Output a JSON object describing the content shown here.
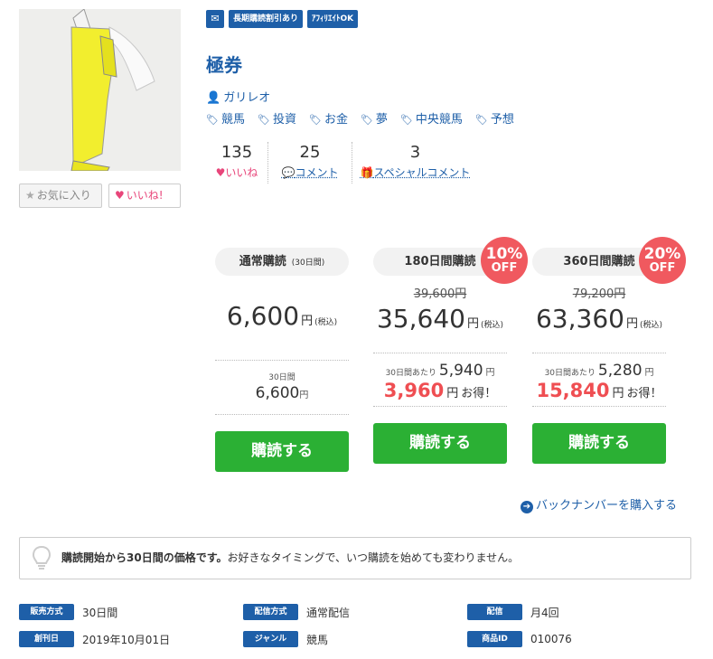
{
  "badges": [
    "✉",
    "長期購読割引あり",
    "ｱﾌｨﾘｴｲﾄOK"
  ],
  "title": "極券",
  "author": "ガリレオ",
  "tags": [
    "競馬",
    "投資",
    "お金",
    "夢",
    "中央競馬",
    "予想"
  ],
  "stats": {
    "likes": {
      "value": "135",
      "label": "いいね"
    },
    "comments": {
      "value": "25",
      "label": "コメント"
    },
    "special": {
      "value": "3",
      "label": "スペシャルコメント"
    }
  },
  "buttons": {
    "favorite": "お気に入り",
    "like": "いいね!"
  },
  "plans": [
    {
      "name": "通常購読",
      "period": "(30日間)",
      "original": "",
      "price": "6,600",
      "yen": "円",
      "tax": "(税込)",
      "unit_prefix": "30日間",
      "unit_price": "6,600",
      "unit_yen": "円",
      "saving": "",
      "saving_label": "",
      "discount": "",
      "buy": "購読する"
    },
    {
      "name": "180日間購読",
      "period": "",
      "original": "39,600円",
      "price": "35,640",
      "yen": "円",
      "tax": "(税込)",
      "unit_prefix": "30日間あたり",
      "unit_price": "5,940",
      "unit_yen": "円",
      "saving": "3,960",
      "saving_label": "お得！",
      "discount": "10%",
      "buy": "購読する"
    },
    {
      "name": "360日間購読",
      "period": "",
      "original": "79,200円",
      "price": "63,360",
      "yen": "円",
      "tax": "(税込)",
      "unit_prefix": "30日間あたり",
      "unit_price": "5,280",
      "unit_yen": "円",
      "saving": "15,840",
      "saving_label": "お得！",
      "discount": "20%",
      "buy": "購読する"
    }
  ],
  "discount_off": "OFF",
  "backnumber": "バックナンバーを購入する",
  "notice": {
    "bold": "購読開始から30日間の価格です。",
    "rest": "お好きなタイミングで、いつ購読を始めても変わりません。"
  },
  "specs": [
    {
      "key": "販売方式",
      "value": "30日間"
    },
    {
      "key": "配信方式",
      "value": "通常配信"
    },
    {
      "key": "配信",
      "value": "月4回"
    },
    {
      "key": "創刊日",
      "value": "2019年10月01日"
    },
    {
      "key": "ジャンル",
      "value": "競馬"
    },
    {
      "key": "商品ID",
      "value": "010076"
    }
  ],
  "colors": {
    "brand": "#1e5fa8",
    "buy": "#2bb034",
    "discount": "#f0595f",
    "like": "#e8457a"
  }
}
